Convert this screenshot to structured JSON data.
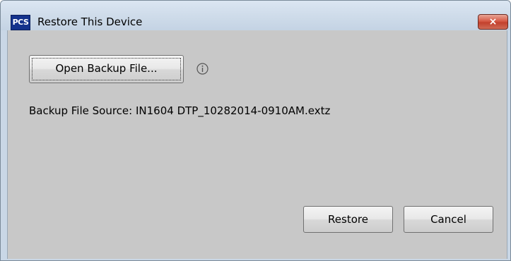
{
  "window": {
    "title": "Restore This Device",
    "app_icon_text": "PCS",
    "close_glyph": "×"
  },
  "content": {
    "open_button_label": "Open Backup File...",
    "info_icon": "info-icon",
    "source_label": "Backup File Source:",
    "source_value": "IN1604 DTP_10282014-0910AM.extz"
  },
  "footer": {
    "restore_label": "Restore",
    "cancel_label": "Cancel"
  },
  "colors": {
    "title_bar": "#cfdcea",
    "client_background": "#c8c8c8",
    "close_button": "#c2412d",
    "app_icon": "#14328c"
  }
}
